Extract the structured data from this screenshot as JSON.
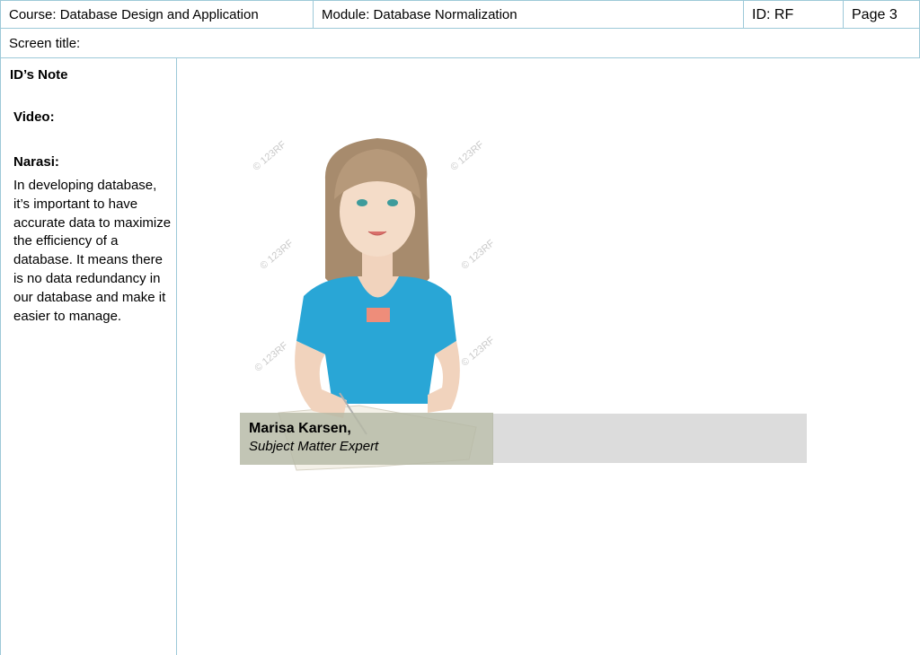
{
  "header": {
    "course": "Course:  Database Design and Application",
    "module": "Module: Database Normalization",
    "id": "ID: RF",
    "page": "Page 3"
  },
  "screen_title": "Screen title:",
  "sidebar": {
    "heading": "ID’s Note",
    "video_label": "Video:",
    "narasi_label": "Narasi:",
    "narasi_text": "In developing database, it’s important to have accurate data to maximize the efficiency of a database. It means there is no data redundancy in our database and make it easier to manage."
  },
  "caption": {
    "name": "Marisa Karsen,",
    "role": "Subject Matter Expert"
  }
}
